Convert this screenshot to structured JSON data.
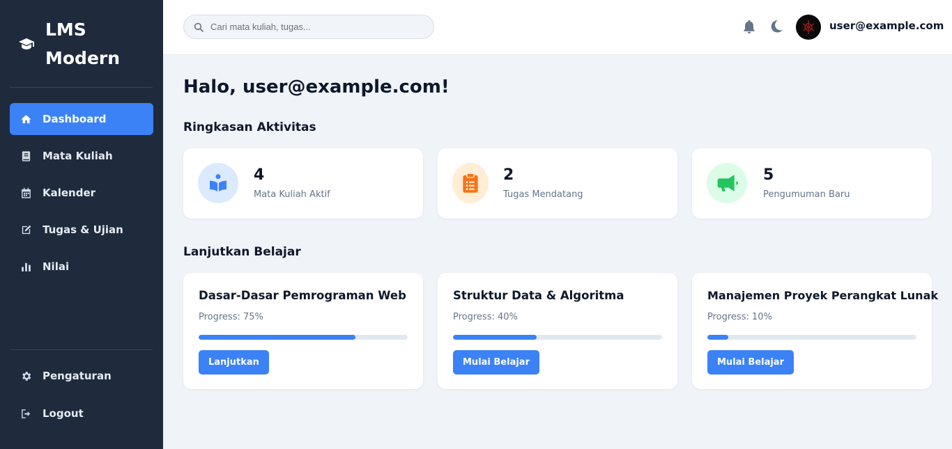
{
  "brand": {
    "title": "LMS Modern",
    "icon": "graduation-cap-icon"
  },
  "sidebar": {
    "items": [
      {
        "label": "Dashboard",
        "icon": "home-icon",
        "active": true
      },
      {
        "label": "Mata Kuliah",
        "icon": "book-icon"
      },
      {
        "label": "Kalender",
        "icon": "calendar-icon"
      },
      {
        "label": "Tugas & Ujian",
        "icon": "edit-icon"
      },
      {
        "label": "Nilai",
        "icon": "bar-chart-icon"
      }
    ],
    "bottom": [
      {
        "label": "Pengaturan",
        "icon": "gear-icon"
      },
      {
        "label": "Logout",
        "icon": "logout-icon"
      }
    ]
  },
  "topbar": {
    "search_placeholder": "Cari mata kuliah, tugas...",
    "user_email": "user@example.com"
  },
  "main": {
    "greeting": "Halo, user@example.com!",
    "summary_title": "Ringkasan Aktivitas",
    "stats": [
      {
        "value": "4",
        "label": "Mata Kuliah Aktif",
        "icon": "book-open-icon",
        "color": "#3b82f6",
        "bg": "#dbeafe"
      },
      {
        "value": "2",
        "label": "Tugas Mendatang",
        "icon": "clipboard-list-icon",
        "color": "#f97316",
        "bg": "#ffedd5"
      },
      {
        "value": "5",
        "label": "Pengumuman Baru",
        "icon": "megaphone-icon",
        "color": "#22c55e",
        "bg": "#dcfce7"
      }
    ],
    "continue_title": "Lanjutkan Belajar",
    "courses": [
      {
        "title": "Dasar-Dasar Pemrograman Web",
        "progress_text": "Progress: 75%",
        "progress": 0.75,
        "button": "Lanjutkan"
      },
      {
        "title": "Struktur Data & Algoritma",
        "progress_text": "Progress: 40%",
        "progress": 0.4,
        "button": "Mulai Belajar"
      },
      {
        "title": "Manajemen Proyek Perangkat Lunak",
        "progress_text": "Progress: 10%",
        "progress": 0.1,
        "button": "Mulai Belajar"
      }
    ]
  },
  "colors": {
    "sidebar_bg": "#1f2a3d",
    "accent": "#3b82f6",
    "page_bg": "#f0f3f8"
  }
}
